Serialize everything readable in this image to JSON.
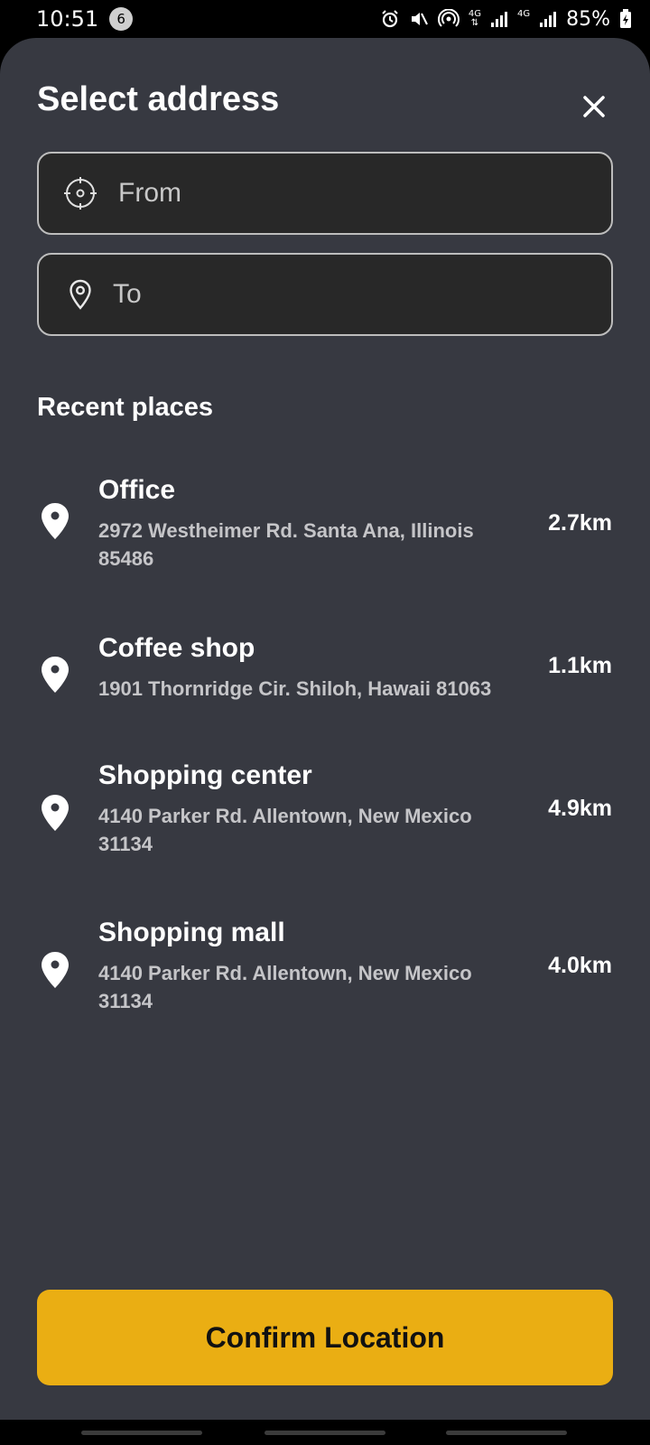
{
  "status_bar": {
    "time": "10:51",
    "notification_count": "6",
    "network_1": "4G",
    "network_2": "4G",
    "battery": "85%"
  },
  "sheet": {
    "title": "Select address",
    "close_icon": "close-icon"
  },
  "fields": {
    "from_placeholder": "From",
    "to_placeholder": "To"
  },
  "recent": {
    "heading": "Recent places",
    "items": [
      {
        "name": "Office",
        "address": "2972 Westheimer Rd. Santa Ana, Illinois 85486",
        "distance": "2.7km"
      },
      {
        "name": "Coffee shop",
        "address": "1901 Thornridge Cir. Shiloh, Hawaii 81063",
        "distance": "1.1km"
      },
      {
        "name": "Shopping center",
        "address": "4140 Parker Rd. Allentown, New Mexico 31134",
        "distance": "4.9km"
      },
      {
        "name": "Shopping mall",
        "address": "4140 Parker Rd. Allentown, New Mexico 31134",
        "distance": "4.0km"
      }
    ]
  },
  "confirm_label": "Confirm Location",
  "colors": {
    "sheet_bg": "#373941",
    "field_bg": "#282828",
    "accent": "#EAAE13"
  }
}
